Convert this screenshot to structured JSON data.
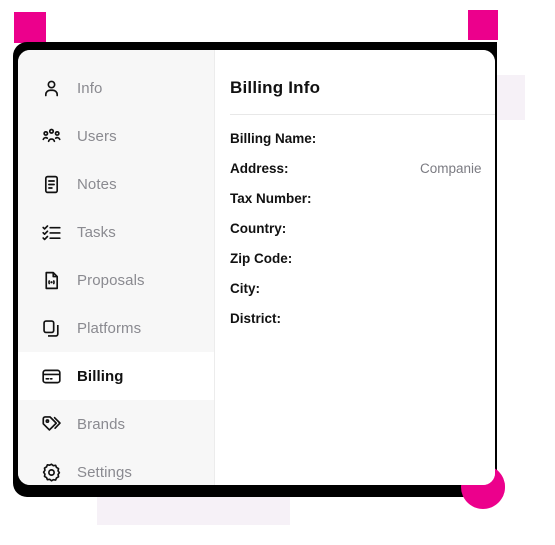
{
  "sidebar": {
    "items": [
      {
        "label": "Info",
        "icon": "person-icon",
        "active": false
      },
      {
        "label": "Users",
        "icon": "users-group-icon",
        "active": false
      },
      {
        "label": "Notes",
        "icon": "notes-icon",
        "active": false
      },
      {
        "label": "Tasks",
        "icon": "checklist-icon",
        "active": false
      },
      {
        "label": "Proposals",
        "icon": "proposal-doc-icon",
        "active": false
      },
      {
        "label": "Platforms",
        "icon": "layers-copy-icon",
        "active": false
      },
      {
        "label": "Billing",
        "icon": "credit-card-icon",
        "active": true
      },
      {
        "label": "Brands",
        "icon": "tags-icon",
        "active": false
      },
      {
        "label": "Settings",
        "icon": "gear-icon",
        "active": false
      }
    ]
  },
  "content": {
    "title": "Billing Info",
    "fields": [
      {
        "label": "Billing Name:",
        "value": ""
      },
      {
        "label": "Address:",
        "value": "Companie"
      },
      {
        "label": "Tax Number:",
        "value": ""
      },
      {
        "label": "Country:",
        "value": ""
      },
      {
        "label": "Zip Code:",
        "value": ""
      },
      {
        "label": "City:",
        "value": ""
      },
      {
        "label": "District:",
        "value": ""
      }
    ]
  },
  "decor": {
    "pink": "#ec008c",
    "frame": "#000000",
    "lavender": "#f6f1f7",
    "sidebar_bg": "#f7f7f7"
  }
}
